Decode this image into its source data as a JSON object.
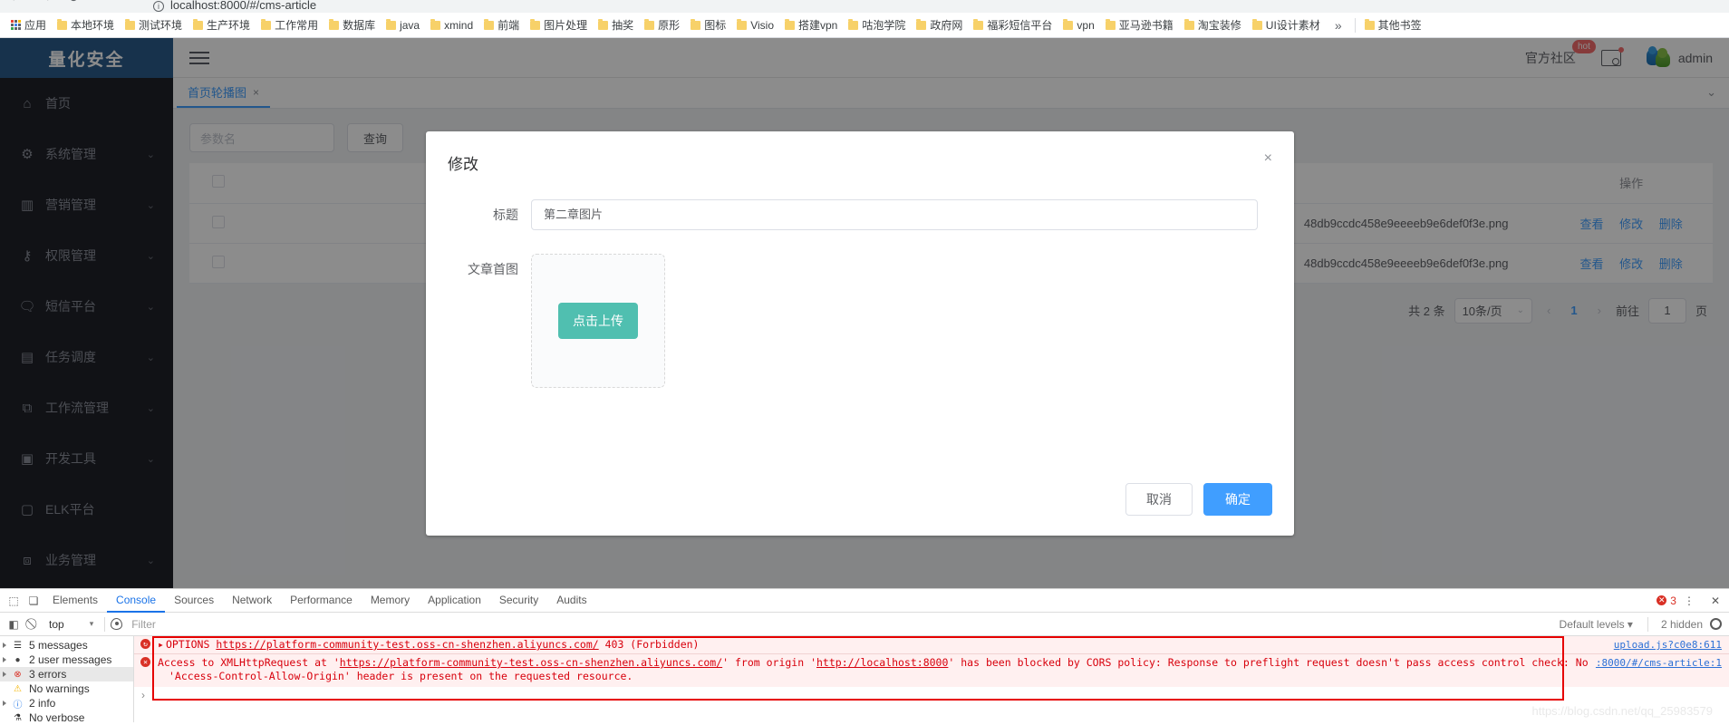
{
  "browser": {
    "url": "localhost:8000/#/cms-article",
    "nav": {
      "back": "←",
      "forward": "→",
      "reload": "⟳"
    },
    "bookmarks": [
      {
        "label": "应用",
        "icon": "apps-grid-icon"
      },
      {
        "label": "本地环境",
        "icon": "folder-icon"
      },
      {
        "label": "测试环境",
        "icon": "folder-icon"
      },
      {
        "label": "生产环境",
        "icon": "folder-icon"
      },
      {
        "label": "工作常用",
        "icon": "folder-icon"
      },
      {
        "label": "数据库",
        "icon": "folder-icon"
      },
      {
        "label": "java",
        "icon": "folder-icon"
      },
      {
        "label": "xmind",
        "icon": "folder-icon"
      },
      {
        "label": "前端",
        "icon": "folder-icon"
      },
      {
        "label": "图片处理",
        "icon": "folder-icon"
      },
      {
        "label": "抽奖",
        "icon": "folder-icon"
      },
      {
        "label": "原形",
        "icon": "folder-icon"
      },
      {
        "label": "图标",
        "icon": "folder-icon"
      },
      {
        "label": "Visio",
        "icon": "folder-icon"
      },
      {
        "label": "搭建vpn",
        "icon": "folder-icon"
      },
      {
        "label": "咕泡学院",
        "icon": "folder-icon"
      },
      {
        "label": "政府网",
        "icon": "folder-icon"
      },
      {
        "label": "福彩短信平台",
        "icon": "folder-icon"
      },
      {
        "label": "vpn",
        "icon": "folder-icon"
      },
      {
        "label": "亚马逊书籍",
        "icon": "folder-icon"
      },
      {
        "label": "淘宝装修",
        "icon": "folder-icon"
      },
      {
        "label": "UI设计素材",
        "icon": "folder-icon"
      }
    ],
    "overflow_label": "»",
    "other_bookmarks": "其他书签"
  },
  "sidebar": {
    "brand": "量化安全",
    "items": [
      {
        "label": "首页",
        "icon": "home-icon",
        "expandable": false
      },
      {
        "label": "系统管理",
        "icon": "gear-icon",
        "expandable": true
      },
      {
        "label": "营销管理",
        "icon": "chart-bar-icon",
        "expandable": true
      },
      {
        "label": "权限管理",
        "icon": "key-icon",
        "expandable": true
      },
      {
        "label": "短信平台",
        "icon": "message-icon",
        "expandable": true
      },
      {
        "label": "任务调度",
        "icon": "task-icon",
        "expandable": true
      },
      {
        "label": "工作流管理",
        "icon": "workflow-icon",
        "expandable": true
      },
      {
        "label": "开发工具",
        "icon": "code-icon",
        "expandable": true
      },
      {
        "label": "ELK平台",
        "icon": "doc-gear-icon",
        "expandable": false
      },
      {
        "label": "业务管理",
        "icon": "business-icon",
        "expandable": true
      }
    ],
    "arrow_glyph": "⌄"
  },
  "topbar": {
    "menu_icon": "hamburger-icon",
    "community_label": "官方社区",
    "hot_badge": "hot",
    "screen_icon": "screen-gear-icon",
    "username": "admin"
  },
  "tabs": {
    "items": [
      {
        "label": "首页轮播图",
        "closable": true
      }
    ],
    "close_glyph": "×",
    "more_glyph": "⌄"
  },
  "content": {
    "search_placeholder": "参数名",
    "query_button": "查询",
    "table": {
      "columns": [
        "",
        "",
        "",
        "操作"
      ],
      "action_header": "操作",
      "rows": [
        {
          "image": "48db9ccdc458e9eeeeb9e6def0f3e.png",
          "actions": [
            "查看",
            "修改",
            "删除"
          ]
        },
        {
          "image": "48db9ccdc458e9eeeeb9e6def0f3e.png",
          "actions": [
            "查看",
            "修改",
            "删除"
          ]
        }
      ]
    },
    "pagination": {
      "total": "共 2 条",
      "page_size": "10条/页",
      "prev": "‹",
      "next": "›",
      "current_page": "1",
      "goto_label": "前往",
      "goto_value": "1",
      "page_unit": "页"
    }
  },
  "modal": {
    "title": "修改",
    "close_glyph": "×",
    "fields": [
      {
        "label": "标题",
        "type": "text",
        "value": "第二章图片"
      },
      {
        "label": "文章首图",
        "type": "upload",
        "button": "点击上传"
      }
    ],
    "cancel": "取消",
    "confirm": "确定",
    "accent_upload": "#50bfb0",
    "accent_primary": "#409eff"
  },
  "devtools": {
    "tabs": [
      "Elements",
      "Console",
      "Sources",
      "Network",
      "Performance",
      "Memory",
      "Application",
      "Security",
      "Audits"
    ],
    "active_tab": "Console",
    "error_count": "3",
    "kebab": "⋮",
    "close_glyph": "✕",
    "context": "top",
    "filter_placeholder": "Filter",
    "levels": "Default levels ▾",
    "hidden_note": "2 hidden",
    "sidebar": [
      {
        "label": "5 messages",
        "icon": "list-icon",
        "selected": false
      },
      {
        "label": "2 user messages",
        "icon": "user-icon",
        "selected": false
      },
      {
        "label": "3 errors",
        "icon": "error-icon",
        "selected": true
      },
      {
        "label": "No warnings",
        "icon": "warning-icon",
        "selected": false
      },
      {
        "label": "2 info",
        "icon": "info-icon",
        "selected": false
      },
      {
        "label": "No verbose",
        "icon": "verbose-icon",
        "selected": false
      }
    ],
    "messages": [
      {
        "prefix": "OPTIONS",
        "link": "https://platform-community-test.oss-cn-shenzhen.aliyuncs.com/",
        "suffix": " 403 (Forbidden)",
        "source": "upload.js?c0e8:611"
      },
      {
        "line1_a": "Access to XMLHttpRequest at '",
        "line1_link1": "https://platform-community-test.oss-cn-shenzhen.aliyuncs.com/",
        "line1_b": "' from origin '",
        "line1_link2": "http://localhost:8000",
        "line1_c": "' has been blocked by CORS policy: Response to preflight request doesn't pass access control check: No",
        "line2": "'Access-Control-Allow-Origin' header is present on the requested resource.",
        "source": ":8000/#/cms-article:1"
      }
    ],
    "prompt_glyph": "›"
  },
  "watermark": "https://blog.csdn.net/qq_25983579"
}
